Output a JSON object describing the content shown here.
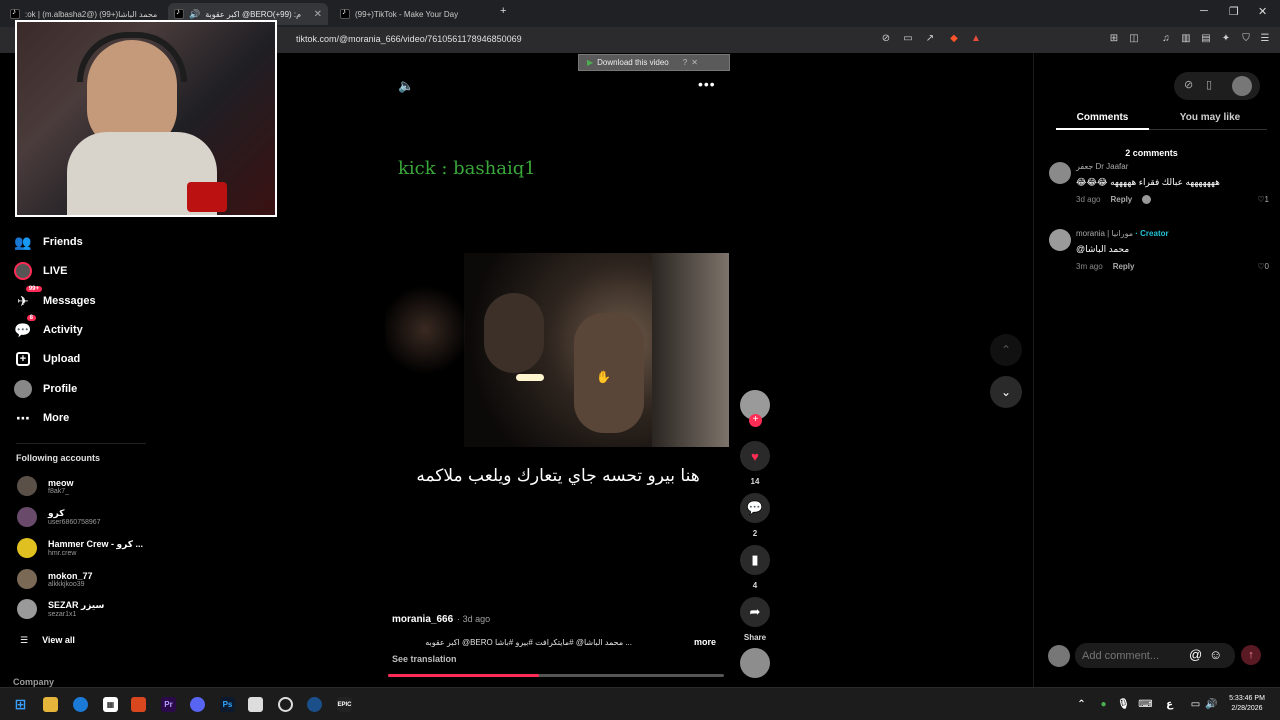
{
  "tabs": [
    {
      "title": "(99+)محمد الباشا (@m.albasha2) | TikTok",
      "display": ":ok | (m.albasha2@) محمد الباشا(+99)"
    },
    {
      "title": "BERO@ اكبر عقوبة (99+)",
      "display": "اكبر عقوبة @BERO(+99) :م"
    },
    {
      "title": "(99+)TikTok - Make Your Day"
    }
  ],
  "new_tab": "+",
  "url": "tiktok.com/@morania_666/video/7610561178946850069",
  "download_btn": "Download this video",
  "sidebar": {
    "items": [
      {
        "label": "Friends",
        "icon": "friends-icon"
      },
      {
        "label": "LIVE",
        "icon": "live-icon"
      },
      {
        "label": "Messages",
        "icon": "messages-icon",
        "badge": "99+"
      },
      {
        "label": "Activity",
        "icon": "activity-icon",
        "badge": "8"
      },
      {
        "label": "Upload",
        "icon": "upload-icon"
      },
      {
        "label": "Profile",
        "icon": "profile-icon"
      },
      {
        "label": "More",
        "icon": "more-icon"
      }
    ],
    "following_title": "Following accounts",
    "accounts": [
      {
        "name": "meow",
        "user": "f8ak7_"
      },
      {
        "name": "كرو",
        "user": "user6860758967"
      },
      {
        "name": "Hammer Crew - كرو ...",
        "user": "hmr.crew"
      },
      {
        "name": "mokon_77",
        "user": "alkkkjkoo39"
      },
      {
        "name": "SEZAR سيزر",
        "user": "sezar1x1"
      }
    ],
    "view_all": "View all",
    "company": "Company"
  },
  "video": {
    "overlay_top": "kick : bashaiq1",
    "caption_overlay": "هنا بيرو تحسه جاي يتعارك ويلعب ملاكمه",
    "author": "morania_666",
    "age": "· 3d ago",
    "description": "اكبر عقوبه @BERO محمد الباشا@ #مايتكرافت #بيرو #باشا ...",
    "more": "more",
    "see_translation": "See translation",
    "progress": 0.45
  },
  "actions": {
    "likes": "14",
    "comments": "2",
    "saves": "4",
    "share": "Share"
  },
  "comments_panel": {
    "tab_comments": "Comments",
    "tab_you_may_like": "You may like",
    "count": "2 comments",
    "items": [
      {
        "name": "جعفر Dr Jaafar",
        "text": "😂😂😂 هههههههه عبالك فقراء هههههه",
        "age": "3d ago",
        "reply": "Reply",
        "likes": "1"
      },
      {
        "name": "morania | مورانيا",
        "creator": "· Creator",
        "text": "@محمد الباشا",
        "age": "3m ago",
        "reply": "Reply",
        "likes": "0"
      }
    ],
    "add_placeholder": "Add comment..."
  },
  "taskbar": {
    "time": "5:33:46 PM",
    "date": "2/28/2026",
    "lang": "ع"
  },
  "colors": {
    "accent": "#fe2c55",
    "creator": "#25c3d6",
    "kick_green": "#3aa83a"
  }
}
